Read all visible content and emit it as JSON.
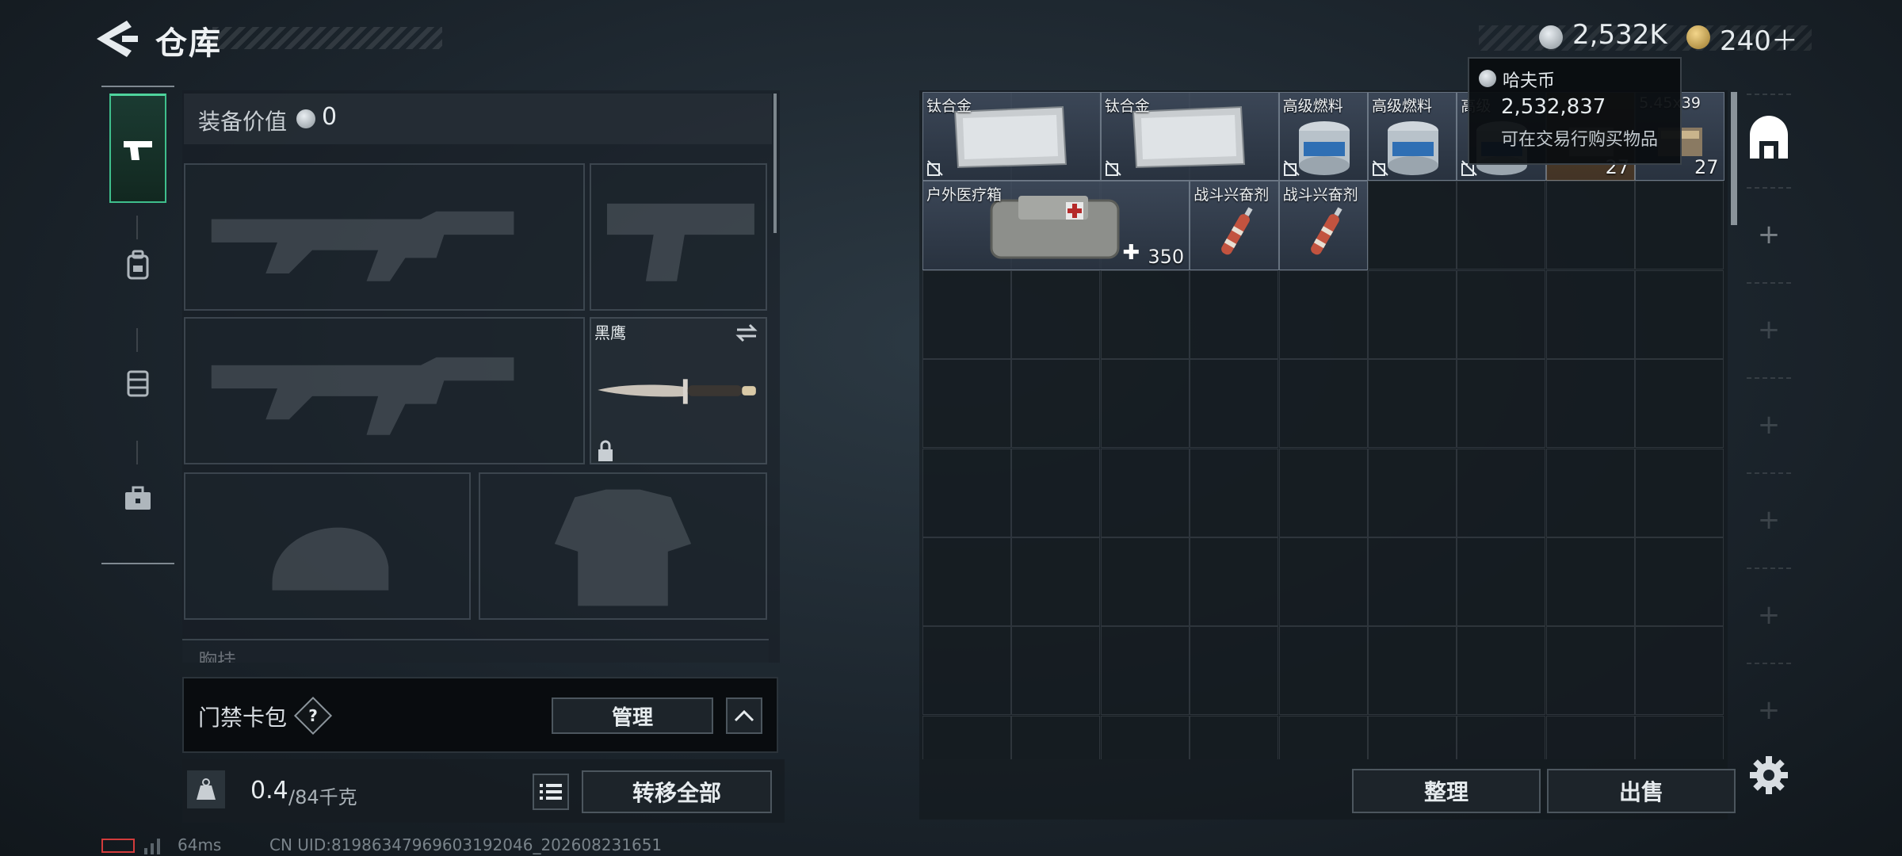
{
  "header": {
    "title": "仓库",
    "currency": [
      {
        "name": "haf-coin",
        "value": "2,532K"
      },
      {
        "name": "gold-coin",
        "value": "240＋"
      }
    ]
  },
  "equipment": {
    "value_label": "装备价值",
    "value": "0",
    "knife_slot_label": "黑鹰",
    "chest_label": "胸挂"
  },
  "card_pack": {
    "label": "门禁卡包",
    "help": "?",
    "manage_label": "管理"
  },
  "weight": {
    "current": "0.4",
    "max": "/84千克",
    "transfer_all_label": "转移全部"
  },
  "status": {
    "ping": "64ms",
    "uid": "CN UID:8198634796960319204​6_202608231651"
  },
  "stash": {
    "items": [
      {
        "name": "钛合金",
        "count": "",
        "kind": "ingot"
      },
      {
        "name": "钛合金",
        "count": "",
        "kind": "ingot"
      },
      {
        "name": "高级燃料",
        "count": "",
        "kind": "fuel"
      },
      {
        "name": "高级燃料",
        "count": "",
        "kind": "fuel"
      },
      {
        "name": "高级",
        "count": "",
        "kind": "fuel"
      },
      {
        "name": "",
        "count": "27",
        "kind": "ammo"
      },
      {
        "name": "5.45x39",
        "count": "27",
        "kind": "ammo"
      },
      {
        "name": "户外医疗箱",
        "count": "350",
        "kind": "medkit"
      },
      {
        "name": "战斗兴奋剂",
        "count": "",
        "kind": "syringe"
      },
      {
        "name": "战斗兴奋剂",
        "count": "",
        "kind": "syringe"
      }
    ]
  },
  "tooltip": {
    "title": "哈夫币",
    "amount": "2,532,837",
    "description": "可在交易行购买物品"
  },
  "actions": {
    "sort_label": "整理",
    "sell_label": "出售"
  },
  "colors": {
    "accent_green": "#3fbf8c",
    "panel_dark": "#090c0f"
  }
}
